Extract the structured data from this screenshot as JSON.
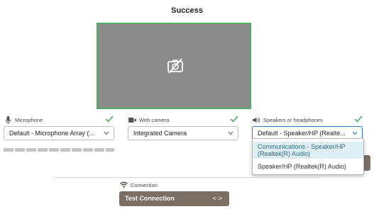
{
  "title": "Success",
  "microphone": {
    "label": "Microphone",
    "selected": "Default - Microphone Array (..."
  },
  "webcam": {
    "label": "Web camera",
    "selected": "Integrated Camera"
  },
  "speakers": {
    "label": "Speakers or headphones",
    "selected": "Default - Speaker/HP (Realte...",
    "options": [
      "Communications - Speaker/HP (Realtek(R) Audio)",
      "Speaker/HP (Realtek(R) Audio)"
    ]
  },
  "connection": {
    "label": "Connection",
    "button_label": "Test Connection",
    "button_icon": "<·>"
  },
  "colors": {
    "check": "#4caf65",
    "accent": "#2d7fb8",
    "button": "#7b6f65"
  },
  "icons": [
    "camera-off-icon",
    "microphone-icon",
    "video-camera-icon",
    "speaker-icon",
    "wifi-icon",
    "check-icon",
    "chevron-down-icon"
  ]
}
